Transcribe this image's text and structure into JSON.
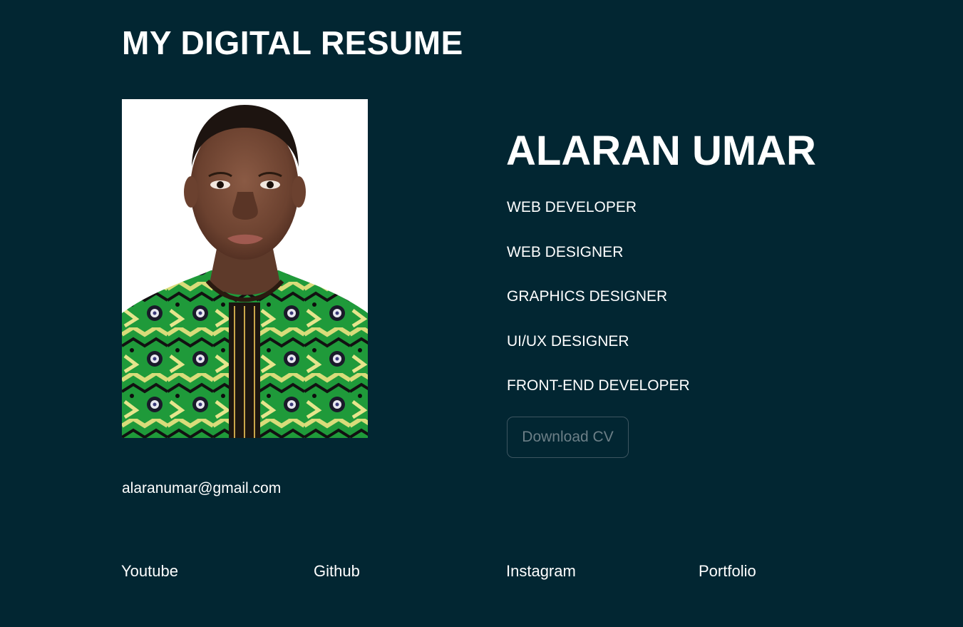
{
  "header": {
    "title": "MY DIGITAL RESUME"
  },
  "profile": {
    "photo_alt": "Profile photo of Alaran Umar",
    "email": "alaranumar@gmail.com",
    "name": "ALARAN UMAR",
    "roles": [
      "WEB DEVELOPER",
      "WEB DESIGNER",
      "GRAPHICS DESIGNER",
      "UI/UX DESIGNER",
      "FRONT-END DEVELOPER"
    ],
    "download_label": "Download CV"
  },
  "social": {
    "youtube": "Youtube",
    "github": "Github",
    "instagram": "Instagram",
    "portfolio": "Portfolio"
  },
  "colors": {
    "background": "#022632",
    "text": "#ffffff",
    "button_text": "#6c7f87",
    "button_border": "#3d5560"
  }
}
